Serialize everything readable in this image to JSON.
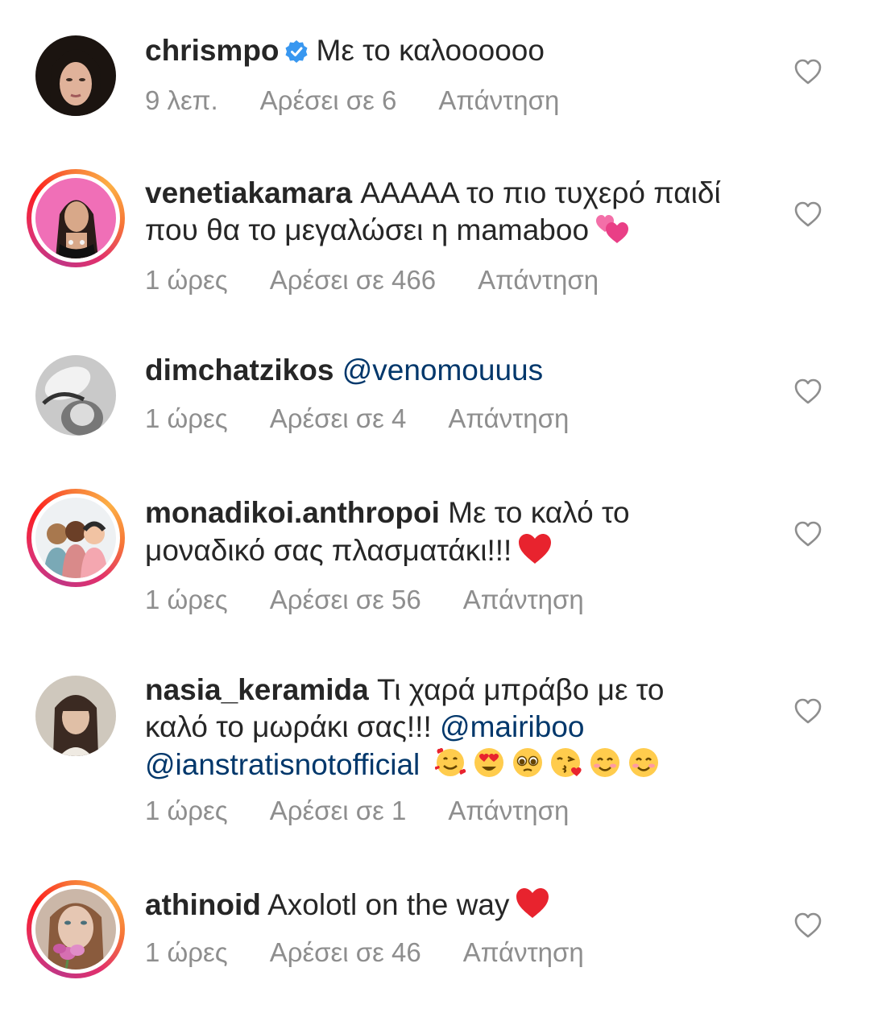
{
  "labels": {
    "reply": "Απάντηση"
  },
  "colors": {
    "mention": "#00376b",
    "meta": "#8e8e8e",
    "story_ring_start": "#c13584",
    "story_ring_end": "#fcaf45"
  },
  "comments": [
    {
      "username": "chrismpo",
      "verified": true,
      "text": "Με το καλοοοοοο",
      "time": "9 λεπ.",
      "likes": "Αρέσει σε 6",
      "story_ring": false,
      "avatar": "woman-dark-hair"
    },
    {
      "username": "venetiakamara",
      "text": "ΑΑΑΑΑ το πιο τυχερό παιδί που θα το μεγαλώσει η mamaboo",
      "emoji": "two-hearts",
      "time": "1 ώρες",
      "likes": "Αρέσει σε 466",
      "story_ring": true,
      "avatar": "woman-pink-background"
    },
    {
      "username": "dimchatzikos",
      "mention": "@venomouuus",
      "time": "1 ώρες",
      "likes": "Αρέσει σε 4",
      "story_ring": false,
      "avatar": "black-white-portrait"
    },
    {
      "username": "monadikoi.anthropoi",
      "text": "Με το καλό το μοναδικό σας πλασματάκι!!!",
      "emoji": "red-heart",
      "time": "1 ώρες",
      "likes": "Αρέσει σε 56",
      "story_ring": true,
      "avatar": "illustrated-people"
    },
    {
      "username": "nasia_keramida",
      "text": "Τι χαρά μπράβο με το καλό το μωράκι σας!!!",
      "mention1": "@mairiboo",
      "mention2": "@ianstratisnotofficial",
      "emojis": [
        "smiling-face-with-hearts",
        "heart-eyes",
        "pleading-face",
        "face-blowing-kiss",
        "smiling-face",
        "smiling-face"
      ],
      "time": "1 ώρες",
      "likes": "Αρέσει σε 1",
      "story_ring": false,
      "avatar": "woman-bangs"
    },
    {
      "username": "athinoid",
      "text": "Axolotl on the way",
      "emoji": "red-heart",
      "time": "1 ώρες",
      "likes": "Αρέσει σε 46",
      "story_ring": true,
      "avatar": "woman-with-flowers"
    }
  ]
}
